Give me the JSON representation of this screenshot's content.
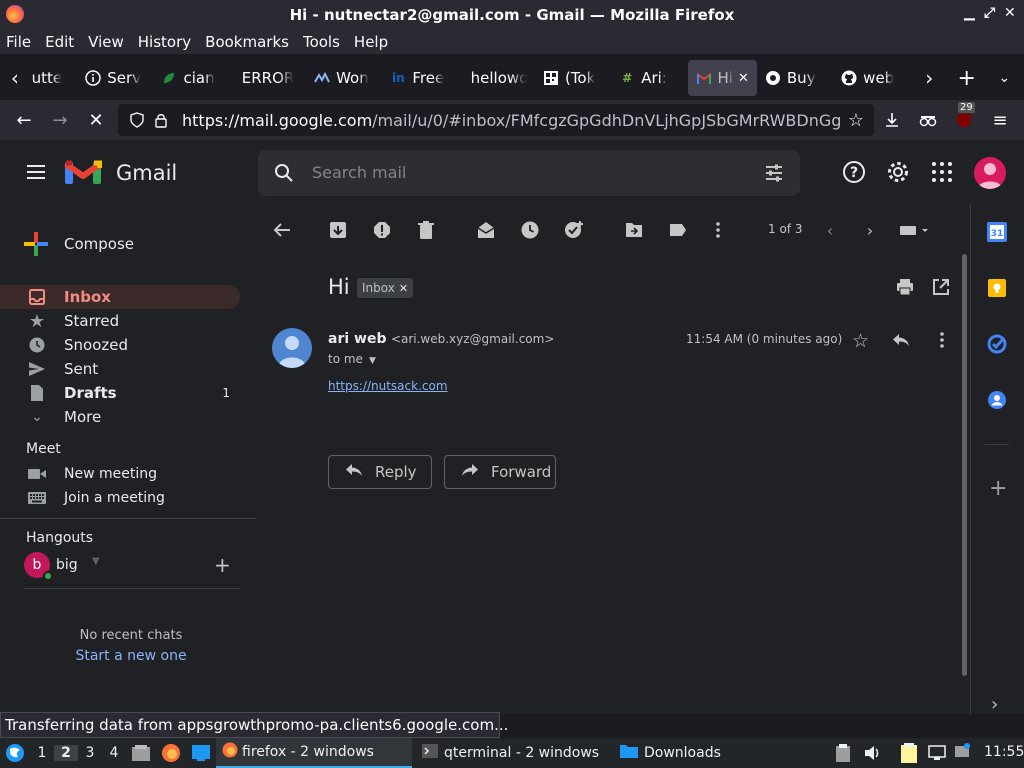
{
  "window": {
    "title": "Hi - nutnectar2@gmail.com - Gmail — Mozilla Firefox"
  },
  "menubar": [
    "File",
    "Edit",
    "View",
    "History",
    "Bookmarks",
    "Tools",
    "Help"
  ],
  "tabs": [
    {
      "label": "utte",
      "icon": "page-icon"
    },
    {
      "label": "Serv",
      "icon": "info-icon"
    },
    {
      "label": "cian",
      "icon": "leaf-icon"
    },
    {
      "label": "ERROR",
      "icon": ""
    },
    {
      "label": "Won",
      "icon": "chart-icon"
    },
    {
      "label": "Free",
      "icon": "linkedin-icon"
    },
    {
      "label": "hellowo",
      "icon": ""
    },
    {
      "label": "(Tok",
      "icon": "qr-icon"
    },
    {
      "label": "Ari:",
      "icon": "hash-icon"
    },
    {
      "label": "Hi",
      "icon": "gmail-icon",
      "active": true
    },
    {
      "label": "Buy",
      "icon": "coin-icon"
    },
    {
      "label": "web",
      "icon": "github-icon"
    }
  ],
  "url": {
    "domain": "https://mail.google.com",
    "path": "/mail/u/0/#inbox/FMfcgzGpGdhDnVLjhGpJSbGMrRWBDnGg"
  },
  "ext_badge": "29",
  "gmail": {
    "brand": "Gmail",
    "search_placeholder": "Search mail",
    "compose": "Compose",
    "nav": [
      {
        "label": "Inbox",
        "active": true
      },
      {
        "label": "Starred"
      },
      {
        "label": "Snoozed"
      },
      {
        "label": "Sent"
      },
      {
        "label": "Drafts",
        "count": "1"
      },
      {
        "label": "More"
      }
    ],
    "meet": {
      "title": "Meet",
      "new_meeting": "New meeting",
      "join": "Join a meeting"
    },
    "hangouts": {
      "title": "Hangouts",
      "user": "big",
      "avatar_letter": "b",
      "no_chats": "No recent chats",
      "start_new": "Start a new one"
    },
    "pagination": "1 of 3",
    "email": {
      "subject": "Hi",
      "label": "Inbox",
      "sender_name": "ari web",
      "sender_email": "<ari.web.xyz@gmail.com>",
      "to": "to me",
      "time": "11:54 AM (0 minutes ago)",
      "link": "https://nutsack.com",
      "reply": "Reply",
      "forward": "Forward"
    },
    "accent": "#f28b82"
  },
  "status": "Transferring data from appsgrowthpromo-pa.clients6.google.com...",
  "taskbar": {
    "workspaces": [
      "1",
      "2",
      "3",
      "4"
    ],
    "firefox": "firefox - 2 windows",
    "qterminal": "qterminal - 2 windows",
    "downloads": "Downloads",
    "clock": "11:55"
  }
}
